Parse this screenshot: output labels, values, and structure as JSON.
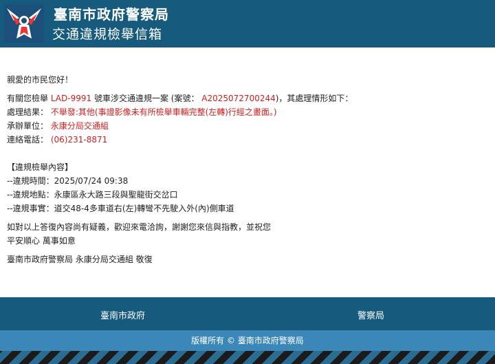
{
  "header": {
    "agency": "臺南市政府警察局",
    "subtitle": "交通違規檢舉信箱"
  },
  "letter": {
    "greeting": "親愛的市民您好！",
    "line1_prefix": "有關您檢舉",
    "plate": "LAD-9991",
    "line1_mid": "號車涉交通違規一案 (案號：",
    "case_no": "A2025072700244",
    "line1_suffix": ")，其處理情形如下：",
    "result_label": "處理結果：",
    "result_value": "不舉發:其他(事證影像未有所檢舉車輛完整(左轉)行經之畫面。)",
    "unit_label": "承辦單位：",
    "unit_value": "永康分局交通組",
    "phone_label": "連絡電話：",
    "phone_value": "(06)231-8871",
    "section_title": "【違規檢舉內容】",
    "time_line": "--違規時間：2025/07/24 09:38",
    "place_line": "--違規地點：永康區永大路三段與聖龍街交岔口",
    "fact_line": "--違規事實：道交48-4多車道右(左)轉彎不先駛入外(內)側車道",
    "closing1": "如對以上答復內容尚有疑義，歡迎來電洽詢，謝謝您來信與指教，並祝您",
    "closing2": "平安順心 萬事如意",
    "signature": "臺南市政府警察局 永康分局交通組 敬復"
  },
  "footer": {
    "link1": "臺南市政府",
    "link2": "警察局",
    "copyright": "版權所有 © 臺南市政府警察局"
  }
}
